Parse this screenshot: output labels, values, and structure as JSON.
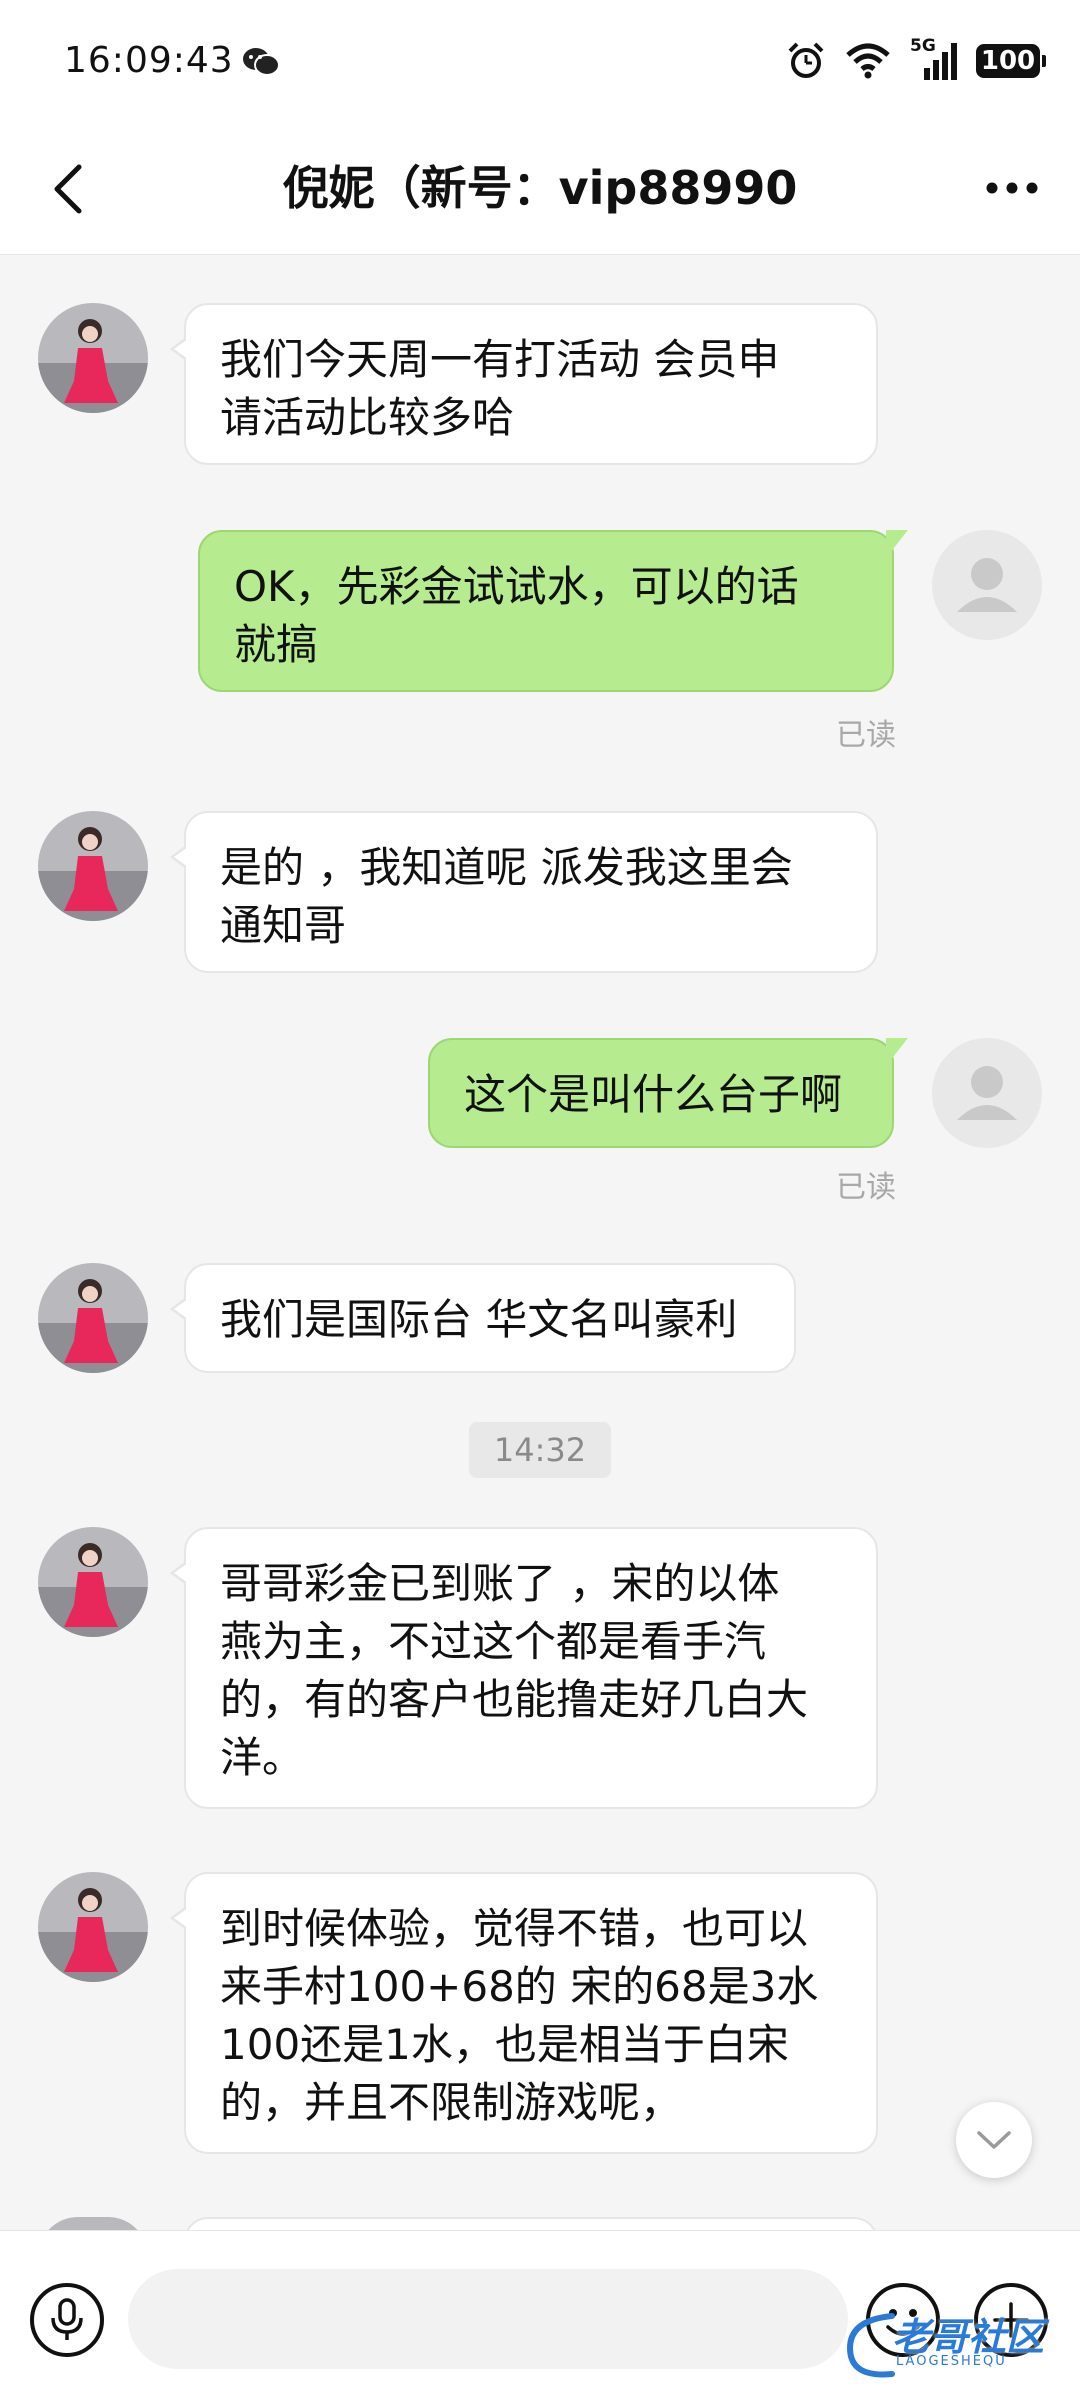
{
  "status_bar": {
    "time": "16:09:43",
    "network": "5G",
    "battery": "100"
  },
  "header": {
    "title": "倪妮（新号：vip88990"
  },
  "messages": [
    {
      "side": "in",
      "text": "我们今天周一有打活动 会员申\n请活动比较多哈"
    },
    {
      "side": "out",
      "text": "OK，先彩金试试水，可以的话\n就搞",
      "read": "已读"
    },
    {
      "side": "in",
      "text": "是的 ，我知道呢  派发我这里会\n通知哥"
    },
    {
      "side": "out",
      "text": "这个是叫什么台子啊",
      "read": "已读"
    },
    {
      "side": "in",
      "text": "我们是国际台 华文名叫豪利"
    },
    {
      "side": "in",
      "text": "哥哥彩金已到账了 ，宋的以体\n燕为主，不过这个都是看手汽\n的，有的客户也能撸走好几白大\n洋。"
    },
    {
      "side": "in",
      "text": "到时候体验，觉得不错，也可以\n来手村100+68的 宋的68是3水\n100还是1水，也是相当于白宋\n的，并且不限制游戏呢，"
    }
  ],
  "timestamp_divider": "14:32",
  "input": {
    "value": ""
  },
  "watermark": {
    "text": "老哥社区",
    "sub": "LAOGESHEQU"
  },
  "colors": {
    "outgoing_bubble": "#b6ec8f",
    "incoming_bubble": "#ffffff",
    "background": "#f5f5f5"
  }
}
